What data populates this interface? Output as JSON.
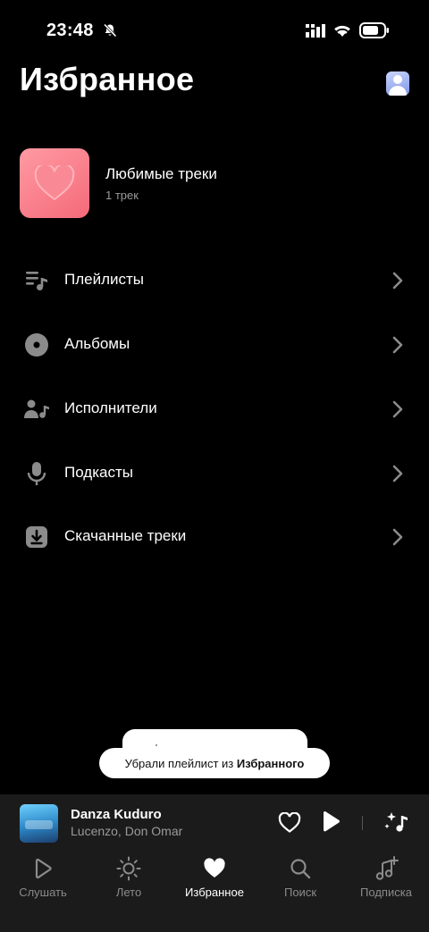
{
  "status": {
    "time": "23:48"
  },
  "header": {
    "title": "Избранное"
  },
  "favorite_tracks": {
    "title": "Любимые треки",
    "subtitle": "1 трек"
  },
  "menu": [
    {
      "label": "Плейлисты",
      "icon": "playlist-icon"
    },
    {
      "label": "Альбомы",
      "icon": "disc-icon"
    },
    {
      "label": "Исполнители",
      "icon": "artists-icon"
    },
    {
      "label": "Подкасты",
      "icon": "microphone-icon"
    },
    {
      "label": "Скачанные треки",
      "icon": "download-icon"
    }
  ],
  "toast": {
    "text": "Убрали плейлист из ",
    "bold": "Избранного"
  },
  "player": {
    "title": "Danza Kuduro",
    "artist": "Lucenzo, Don Omar"
  },
  "tabs": [
    {
      "label": "Слушать",
      "icon": "play-outline-icon",
      "active": false
    },
    {
      "label": "Лето",
      "icon": "sun-icon",
      "active": false
    },
    {
      "label": "Избранное",
      "icon": "heart-icon",
      "active": true
    },
    {
      "label": "Поиск",
      "icon": "search-icon",
      "active": false
    },
    {
      "label": "Подписка",
      "icon": "music-plus-icon",
      "active": false
    }
  ],
  "colors": {
    "background": "#000000",
    "panel": "#1b1b1b",
    "muted": "#8b8b8b",
    "cover": "#f46a7a"
  }
}
